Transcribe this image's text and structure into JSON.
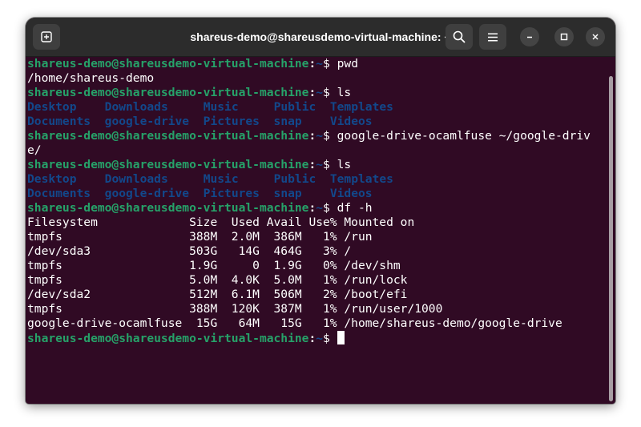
{
  "window": {
    "title": "shareus-demo@shareusdemo-virtual-machine: ~"
  },
  "icons": {
    "new_tab": "new-tab-icon",
    "search": "search-icon",
    "menu": "hamburger-menu-icon",
    "minimize": "minimize-icon",
    "maximize": "maximize-icon",
    "close": "close-icon"
  },
  "colors": {
    "terminal_bg": "#300a24",
    "titlebar_bg": "#2c2c2c",
    "prompt_user": "#26a269",
    "prompt_path": "#12488b",
    "directory": "#12488b",
    "text": "#ffffff"
  },
  "prompt": {
    "user_host": "shareus-demo@shareusdemo-virtual-machine",
    "separator": ":",
    "path": "~",
    "symbol": "$ "
  },
  "session": {
    "cmd1": "pwd",
    "out1": "/home/shareus-demo",
    "cmd2": "ls",
    "ls1_row1": [
      "Desktop",
      "Downloads",
      "Music",
      "Public",
      "Templates"
    ],
    "ls1_row2": [
      "Documents",
      "google-drive",
      "Pictures",
      "snap",
      "Videos"
    ],
    "cmd3": "google-drive-ocamlfuse ~/google-driv",
    "cmd3_wrap": "e/",
    "cmd4": "ls",
    "ls2_row1": [
      "Desktop",
      "Downloads",
      "Music",
      "Public",
      "Templates"
    ],
    "ls2_row2": [
      "Documents",
      "google-drive",
      "Pictures",
      "snap",
      "Videos"
    ],
    "cmd5": "df -h",
    "df_header": "Filesystem             Size  Used Avail Use% Mounted on",
    "df_rows": [
      "tmpfs                  388M  2.0M  386M   1% /run",
      "/dev/sda3              503G   14G  464G   3% /",
      "tmpfs                  1.9G     0  1.9G   0% /dev/shm",
      "tmpfs                  5.0M  4.0K  5.0M   1% /run/lock",
      "/dev/sda2              512M  6.1M  506M   2% /boot/efi",
      "tmpfs                  388M  120K  387M   1% /run/user/1000",
      "google-drive-ocamlfuse  15G   64M   15G   1% /home/shareus-demo/google-drive"
    ]
  }
}
